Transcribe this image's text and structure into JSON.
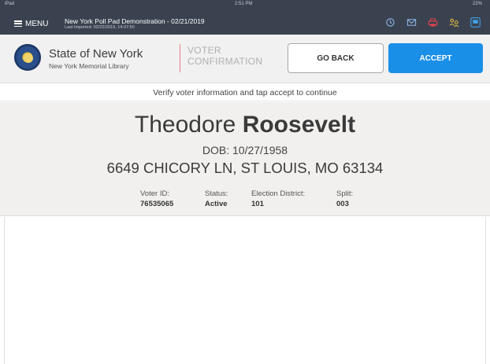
{
  "status_bar": {
    "device": "iPad",
    "time": "2:51 PM",
    "battery": "22%"
  },
  "app_bar": {
    "menu_label": "MENU",
    "title": "New York Poll Pad Demonstration - 02/21/2019",
    "subtitle": "Last Imported: 02/22/2019, 14:37:50",
    "icons": [
      "history-icon",
      "mail-icon",
      "printer-icon",
      "users-icon",
      "chat-icon"
    ],
    "colors": {
      "bar": "#3a4250",
      "printer": "#e2424f",
      "users": "#e8c43a",
      "chat": "#3fa1e8"
    }
  },
  "header": {
    "org_name": "State of New York",
    "org_sub": "New York Memorial Library",
    "page_label_line1": "VOTER",
    "page_label_line2": "CONFIRMATION",
    "go_back_label": "GO BACK",
    "accept_label": "ACCEPT",
    "accent": "#1a8fe8"
  },
  "instruction": "Verify voter information and tap accept to continue",
  "voter": {
    "first_name": "Theodore",
    "last_name": "Roosevelt",
    "dob_label": "DOB:",
    "dob": "10/27/1958",
    "address": "6649 CHICORY LN, ST LOUIS, MO 63134",
    "fields": {
      "voter_id": {
        "label": "Voter ID:",
        "value": "76535065"
      },
      "status": {
        "label": "Status:",
        "value": "Active"
      },
      "district": {
        "label": "Election District:",
        "value": "101"
      },
      "split": {
        "label": "Split:",
        "value": "003"
      }
    }
  }
}
